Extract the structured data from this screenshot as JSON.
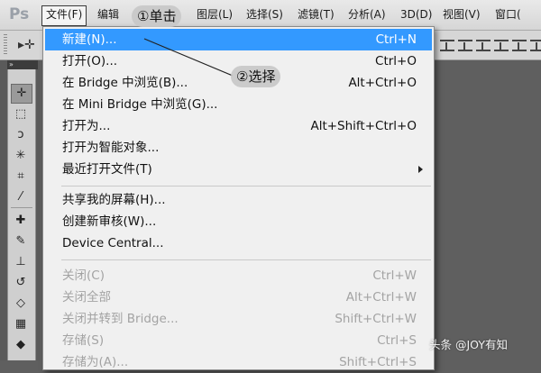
{
  "app": {
    "logo": "Ps"
  },
  "menubar": {
    "items": [
      "文件(F)",
      "编辑",
      "图层(L)",
      "选择(S)",
      "滤镜(T)",
      "分析(A)",
      "3D(D)",
      "视图(V)",
      "窗口("
    ]
  },
  "toolpanel": {
    "collapse_label": "»"
  },
  "file_menu": {
    "items": [
      {
        "label": "新建(N)...",
        "shortcut": "Ctrl+N",
        "highlighted": true
      },
      {
        "label": "打开(O)...",
        "shortcut": "Ctrl+O"
      },
      {
        "label": "在 Bridge 中浏览(B)...",
        "shortcut": "Alt+Ctrl+O"
      },
      {
        "label": "在 Mini Bridge 中浏览(G)...",
        "shortcut": ""
      },
      {
        "label": "打开为...",
        "shortcut": "Alt+Shift+Ctrl+O"
      },
      {
        "label": "打开为智能对象...",
        "shortcut": ""
      },
      {
        "label": "最近打开文件(T)",
        "shortcut": "",
        "submenu": true
      },
      {
        "label": "共享我的屏幕(H)...",
        "shortcut": ""
      },
      {
        "label": "创建新审核(W)...",
        "shortcut": ""
      },
      {
        "label": "Device Central...",
        "shortcut": ""
      },
      {
        "label": "关闭(C)",
        "shortcut": "Ctrl+W",
        "disabled": true
      },
      {
        "label": "关闭全部",
        "shortcut": "Alt+Ctrl+W",
        "disabled": true
      },
      {
        "label": "关闭并转到 Bridge...",
        "shortcut": "Shift+Ctrl+W",
        "disabled": true
      },
      {
        "label": "存储(S)",
        "shortcut": "Ctrl+S",
        "disabled": true
      },
      {
        "label": "存储为(A)...",
        "shortcut": "Shift+Ctrl+S",
        "disabled": true
      }
    ]
  },
  "annotations": {
    "step1": "①单击",
    "step2": "②选择"
  },
  "watermark": "头条 @JOY有知",
  "colors": {
    "highlight": "#3399ff",
    "menu_bg": "#f0f0f0",
    "disabled_text": "#a3a3a3"
  }
}
